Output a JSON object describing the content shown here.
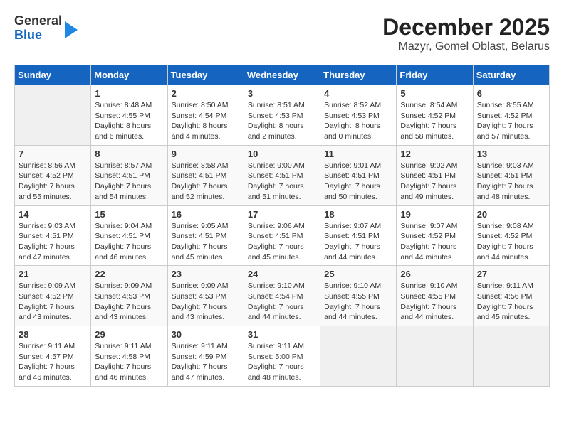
{
  "header": {
    "logo": {
      "line1": "General",
      "line2": "Blue"
    },
    "title": "December 2025",
    "subtitle": "Mazyr, Gomel Oblast, Belarus"
  },
  "days_of_week": [
    "Sunday",
    "Monday",
    "Tuesday",
    "Wednesday",
    "Thursday",
    "Friday",
    "Saturday"
  ],
  "weeks": [
    [
      {
        "day": "",
        "info": ""
      },
      {
        "day": "1",
        "info": "Sunrise: 8:48 AM\nSunset: 4:55 PM\nDaylight: 8 hours\nand 6 minutes."
      },
      {
        "day": "2",
        "info": "Sunrise: 8:50 AM\nSunset: 4:54 PM\nDaylight: 8 hours\nand 4 minutes."
      },
      {
        "day": "3",
        "info": "Sunrise: 8:51 AM\nSunset: 4:53 PM\nDaylight: 8 hours\nand 2 minutes."
      },
      {
        "day": "4",
        "info": "Sunrise: 8:52 AM\nSunset: 4:53 PM\nDaylight: 8 hours\nand 0 minutes."
      },
      {
        "day": "5",
        "info": "Sunrise: 8:54 AM\nSunset: 4:52 PM\nDaylight: 7 hours\nand 58 minutes."
      },
      {
        "day": "6",
        "info": "Sunrise: 8:55 AM\nSunset: 4:52 PM\nDaylight: 7 hours\nand 57 minutes."
      }
    ],
    [
      {
        "day": "7",
        "info": "Sunrise: 8:56 AM\nSunset: 4:52 PM\nDaylight: 7 hours\nand 55 minutes."
      },
      {
        "day": "8",
        "info": "Sunrise: 8:57 AM\nSunset: 4:51 PM\nDaylight: 7 hours\nand 54 minutes."
      },
      {
        "day": "9",
        "info": "Sunrise: 8:58 AM\nSunset: 4:51 PM\nDaylight: 7 hours\nand 52 minutes."
      },
      {
        "day": "10",
        "info": "Sunrise: 9:00 AM\nSunset: 4:51 PM\nDaylight: 7 hours\nand 51 minutes."
      },
      {
        "day": "11",
        "info": "Sunrise: 9:01 AM\nSunset: 4:51 PM\nDaylight: 7 hours\nand 50 minutes."
      },
      {
        "day": "12",
        "info": "Sunrise: 9:02 AM\nSunset: 4:51 PM\nDaylight: 7 hours\nand 49 minutes."
      },
      {
        "day": "13",
        "info": "Sunrise: 9:03 AM\nSunset: 4:51 PM\nDaylight: 7 hours\nand 48 minutes."
      }
    ],
    [
      {
        "day": "14",
        "info": "Sunrise: 9:03 AM\nSunset: 4:51 PM\nDaylight: 7 hours\nand 47 minutes."
      },
      {
        "day": "15",
        "info": "Sunrise: 9:04 AM\nSunset: 4:51 PM\nDaylight: 7 hours\nand 46 minutes."
      },
      {
        "day": "16",
        "info": "Sunrise: 9:05 AM\nSunset: 4:51 PM\nDaylight: 7 hours\nand 45 minutes."
      },
      {
        "day": "17",
        "info": "Sunrise: 9:06 AM\nSunset: 4:51 PM\nDaylight: 7 hours\nand 45 minutes."
      },
      {
        "day": "18",
        "info": "Sunrise: 9:07 AM\nSunset: 4:51 PM\nDaylight: 7 hours\nand 44 minutes."
      },
      {
        "day": "19",
        "info": "Sunrise: 9:07 AM\nSunset: 4:52 PM\nDaylight: 7 hours\nand 44 minutes."
      },
      {
        "day": "20",
        "info": "Sunrise: 9:08 AM\nSunset: 4:52 PM\nDaylight: 7 hours\nand 44 minutes."
      }
    ],
    [
      {
        "day": "21",
        "info": "Sunrise: 9:09 AM\nSunset: 4:52 PM\nDaylight: 7 hours\nand 43 minutes."
      },
      {
        "day": "22",
        "info": "Sunrise: 9:09 AM\nSunset: 4:53 PM\nDaylight: 7 hours\nand 43 minutes."
      },
      {
        "day": "23",
        "info": "Sunrise: 9:09 AM\nSunset: 4:53 PM\nDaylight: 7 hours\nand 43 minutes."
      },
      {
        "day": "24",
        "info": "Sunrise: 9:10 AM\nSunset: 4:54 PM\nDaylight: 7 hours\nand 44 minutes."
      },
      {
        "day": "25",
        "info": "Sunrise: 9:10 AM\nSunset: 4:55 PM\nDaylight: 7 hours\nand 44 minutes."
      },
      {
        "day": "26",
        "info": "Sunrise: 9:10 AM\nSunset: 4:55 PM\nDaylight: 7 hours\nand 44 minutes."
      },
      {
        "day": "27",
        "info": "Sunrise: 9:11 AM\nSunset: 4:56 PM\nDaylight: 7 hours\nand 45 minutes."
      }
    ],
    [
      {
        "day": "28",
        "info": "Sunrise: 9:11 AM\nSunset: 4:57 PM\nDaylight: 7 hours\nand 46 minutes."
      },
      {
        "day": "29",
        "info": "Sunrise: 9:11 AM\nSunset: 4:58 PM\nDaylight: 7 hours\nand 46 minutes."
      },
      {
        "day": "30",
        "info": "Sunrise: 9:11 AM\nSunset: 4:59 PM\nDaylight: 7 hours\nand 47 minutes."
      },
      {
        "day": "31",
        "info": "Sunrise: 9:11 AM\nSunset: 5:00 PM\nDaylight: 7 hours\nand 48 minutes."
      },
      {
        "day": "",
        "info": ""
      },
      {
        "day": "",
        "info": ""
      },
      {
        "day": "",
        "info": ""
      }
    ]
  ]
}
